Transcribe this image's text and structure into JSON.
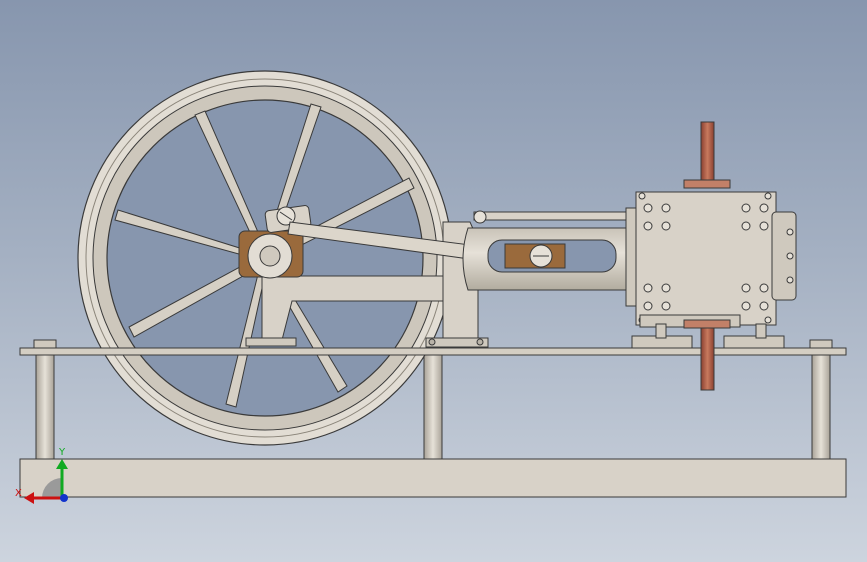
{
  "viewport": {
    "background_top": "#8796ae",
    "background_bottom": "#cdd4de"
  },
  "colors": {
    "metal": "#d8d2c8",
    "metal_shadow": "#a9a398",
    "outline": "#3a3a3a",
    "copper": "#b8694f",
    "brass": "#9a6a3c"
  },
  "triad": {
    "x_label": "X",
    "y_label": "Y",
    "x_color": "#cc1111",
    "y_color": "#11aa22",
    "z_color": "#1133cc"
  }
}
